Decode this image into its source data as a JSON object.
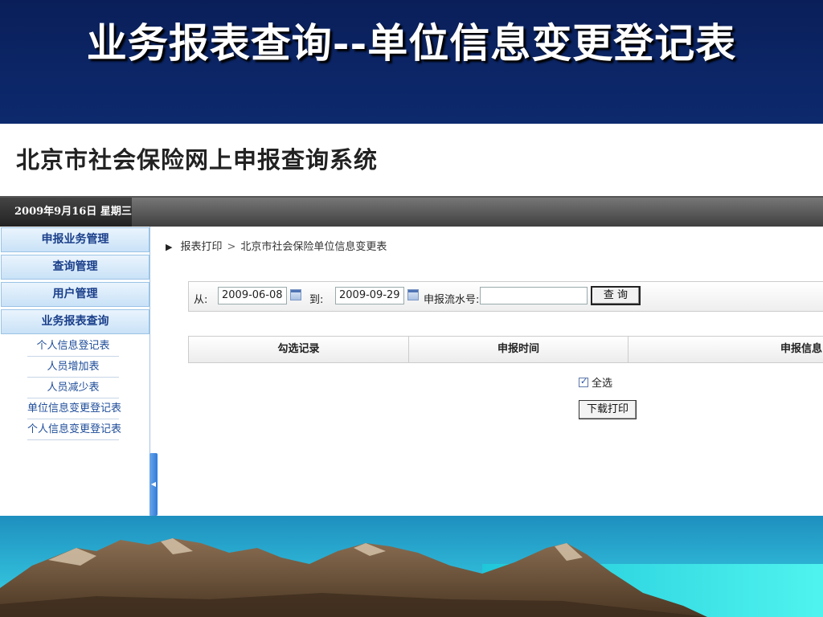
{
  "slide": {
    "title": "业务报表查询--单位信息变更登记表"
  },
  "app": {
    "title": "北京市社会保险网上申报查询系统",
    "date": "2009年9月16日 星期三"
  },
  "sidebar": {
    "menu": [
      {
        "label": "申报业务管理"
      },
      {
        "label": "查询管理"
      },
      {
        "label": "用户管理"
      },
      {
        "label": "业务报表查询"
      }
    ],
    "submenu": [
      {
        "label": "个人信息登记表"
      },
      {
        "label": "人员增加表"
      },
      {
        "label": "人员减少表"
      },
      {
        "label": "单位信息变更登记表"
      },
      {
        "label": "个人信息变更登记表"
      }
    ]
  },
  "breadcrumb": {
    "part1": "报表打印",
    "separator": ">",
    "part2": "北京市社会保险单位信息变更表"
  },
  "query": {
    "from_label": "从:",
    "from_value": "2009-06-08",
    "to_label": "到:",
    "to_value": "2009-09-29",
    "serial_label": "申报流水号:",
    "serial_value": "",
    "button": "查 询"
  },
  "table": {
    "columns": [
      "勾选记录",
      "申报时间",
      "申报信息"
    ]
  },
  "select_all": {
    "label": "全选",
    "checked": true
  },
  "download_button": "下载打印",
  "colors": {
    "slide_background": "#0b2462",
    "menu_text": "#1a3f8a",
    "submenu_text": "#1f4d9a"
  }
}
